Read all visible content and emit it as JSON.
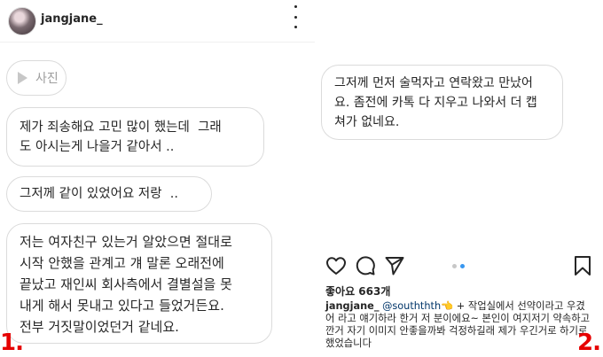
{
  "left_panel": {
    "username": "jangjane_",
    "photo_button_label": "사진",
    "messages": [
      "제가 죄송해요 고민 많이 했는데  그래\n도 아시는게 나을거 같아서 ..",
      "그저께 같이 있었어요 저랑  ..",
      "저는 여자친구 있는거 알았으면 절대로\n시작 안했을 관계고 걔 말론 오래전에\n끝났고 재인씨 회사측에서 결별설을 못\n내게 해서 못내고 있다고 들었거든요.\n전부 거짓말이었던거 같네요."
    ],
    "corner_label": "1."
  },
  "right_panel": {
    "message": "그저께 먼저 술먹자고 연락왔고 만났어\n요. 좀전에 카톡 다 지우고 나와서 더 캡\n쳐가 없네요.",
    "likes": "좋아요 663개",
    "caption": {
      "username": "jangjane_",
      "handle": "@souththth",
      "emoji": "👈",
      "text_line1": " + 작업실에서 선약이라고 우겼",
      "text_rest": "어 라고 얘기하라 한거 저 분이에요~ 본인이 여지저기 약속하고\n깐거 자기 이미지 안좋을까봐 걱정하길래 제가 우긴거로 하기로\n했었습니다"
    },
    "carousel": {
      "count": 2,
      "active_index": 1
    },
    "corner_label": "2."
  },
  "colors": {
    "accent_red": "#e60000",
    "carousel_active": "#3897f0",
    "border": "#dbdbdb"
  },
  "icons": [
    "more-icon",
    "play-icon",
    "heart-icon",
    "comment-icon",
    "send-icon",
    "bookmark-icon"
  ]
}
